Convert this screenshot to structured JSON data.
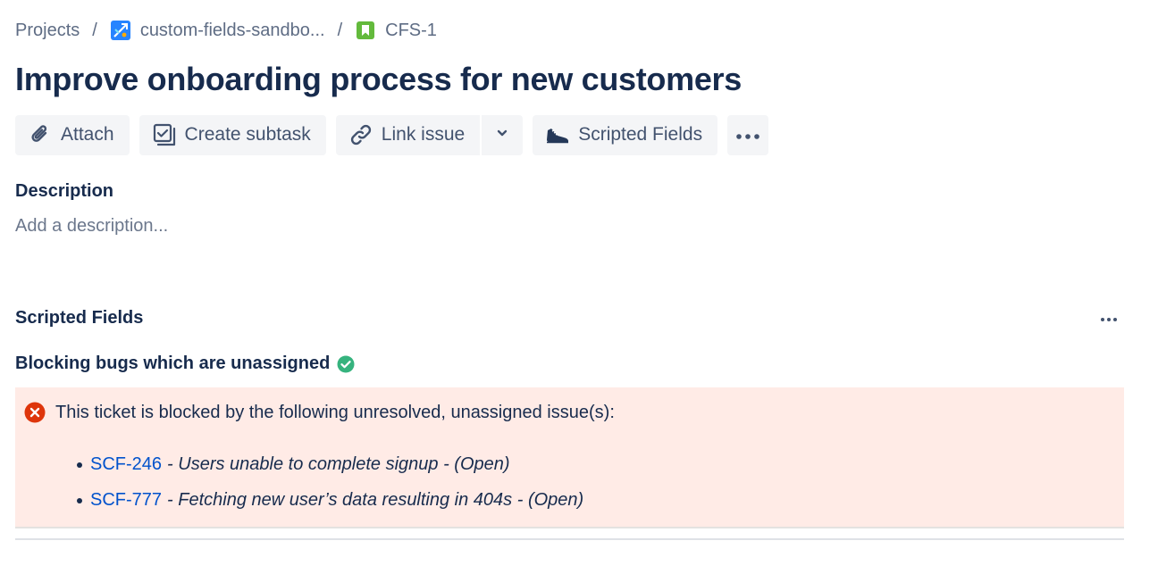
{
  "breadcrumbs": {
    "projects": "Projects",
    "project": "custom-fields-sandbo...",
    "issue_key": "CFS-1",
    "separator": "/"
  },
  "issue": {
    "title": "Improve onboarding process for new customers"
  },
  "toolbar": {
    "attach": "Attach",
    "create_subtask": "Create subtask",
    "link_issue": "Link issue",
    "scripted_fields": "Scripted Fields"
  },
  "description": {
    "label": "Description",
    "placeholder": "Add a description..."
  },
  "scripted_fields": {
    "heading": "Scripted Fields",
    "field": {
      "name": "Blocking bugs which are unassigned",
      "message": "This ticket is blocked by the following unresolved, unassigned issue(s):",
      "issues": [
        {
          "key": "SCF-246",
          "summary": "- Users unable to complete signup - (Open)"
        },
        {
          "key": "SCF-777",
          "summary": "- Fetching new user’s data resulting in 404s - (Open)"
        }
      ]
    }
  },
  "icons": {
    "project": "project-avatar-icon",
    "issue_type": "story-icon",
    "attach": "paperclip-icon",
    "subtask": "subtask-icon",
    "link": "link-icon",
    "dropdown": "chevron-down-icon",
    "scripted_fields": "shoe-icon",
    "more": "more-horizontal-icon",
    "status_ok": "check-circle-icon",
    "error": "error-circle-icon"
  },
  "colors": {
    "link": "#0052cc",
    "text": "#172b4d",
    "muted": "#5e6c84",
    "error_bg": "#ffebe6",
    "error": "#de350b",
    "success": "#36b37e",
    "button_bg": "#f4f5f7"
  }
}
